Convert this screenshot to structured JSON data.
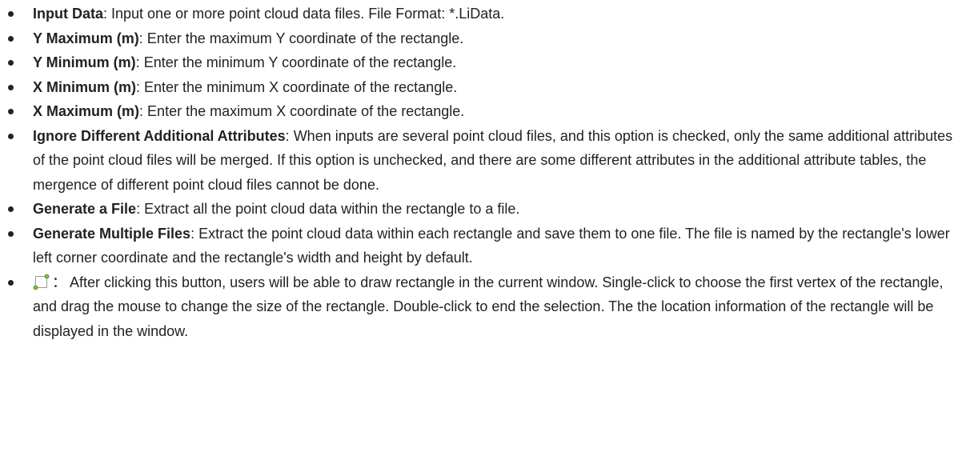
{
  "items": [
    {
      "term": "Input Data",
      "sep": ": ",
      "desc": "Input one or more point cloud data files. File Format: *.LiData."
    },
    {
      "term": "Y Maximum (m)",
      "sep": ": ",
      "desc": "Enter the maximum Y coordinate of the rectangle."
    },
    {
      "term": "Y Minimum (m)",
      "sep": ": ",
      "desc": "Enter the minimum Y coordinate of the rectangle."
    },
    {
      "term": "X Minimum (m)",
      "sep": ": ",
      "desc": "Enter the minimum X coordinate of the rectangle."
    },
    {
      "term": "X Maximum (m)",
      "sep": ": ",
      "desc": "Enter the maximum X coordinate of the rectangle."
    },
    {
      "term": "Ignore Different Additional Attributes",
      "sep": ": ",
      "desc": "When inputs are several point cloud files, and this option is checked, only the same additional attributes of the point cloud files will be merged. If this option is unchecked, and there are some different attributes in the additional attribute tables, the mergence of different point cloud files cannot be done."
    },
    {
      "term": "Generate a File",
      "sep": ": ",
      "desc": "Extract all the point cloud data within the rectangle to a file."
    },
    {
      "term": "Generate Multiple Files",
      "sep": ": ",
      "desc": "Extract the point cloud data within each rectangle and save them to one file. The file is named by the rectangle's lower left corner coordinate and the rectangle's width and height by default."
    },
    {
      "icon": "draw-rectangle-icon",
      "sep": "： ",
      "desc": "After clicking this button, users will be able to draw rectangle in the current window. Single-click to choose the first vertex of the rectangle, and drag the mouse to change the size of the rectangle. Double-click to end the selection. The the location information of the rectangle will be displayed in the window."
    }
  ]
}
